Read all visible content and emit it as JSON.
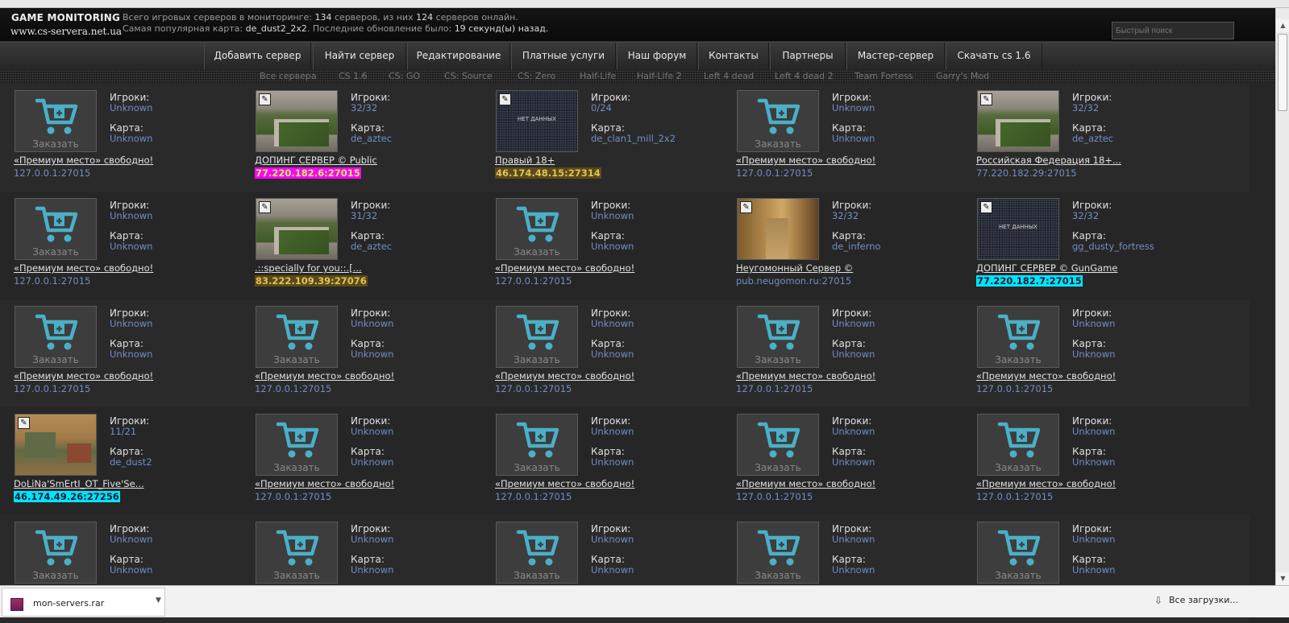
{
  "header": {
    "logo_title": "GAME MONITORING",
    "logo_url": "www.cs-servera.net.ua",
    "stats_line1_prefix": "Всего игровых серверов в мониторинге:",
    "stats_total": "134",
    "stats_line1_mid": "серверов, из них",
    "stats_online": "124",
    "stats_line1_suffix": "серверов онлайн.",
    "stats_line2_prefix": "Самая популярная карта:",
    "stats_popular_map": "de_dust2_2x2",
    "stats_line2_mid": ". Последние обновление было:",
    "stats_updated": "19 секунд(ы) назад.",
    "search_placeholder": "Быстрый поиск"
  },
  "nav": [
    "Добавить сервер",
    "Найти сервер",
    "Редактирование",
    "Платные услуги",
    "Наш форум",
    "Контакты",
    "Партнеры",
    "Мастер-сервер",
    "Скачать cs 1.6"
  ],
  "games": [
    "Все сервера",
    "CS 1.6",
    "CS: GO",
    "CS: Source",
    "CS: Zero",
    "Half-Life",
    "Half-Life 2",
    "Left 4 dead",
    "Left 4 dead 2",
    "Team Fortess",
    "Garry's Mod"
  ],
  "labels": {
    "players": "Игроки:",
    "map": "Карта:",
    "order": "Заказать",
    "no_data": "НЕТ ДАННЫХ",
    "cs_badge": "✎"
  },
  "servers": [
    [
      {
        "type": "premium",
        "players": "Unknown",
        "map": "Unknown",
        "name": "«Премиум место» свободно!",
        "ip": "127.0.0.1:27015",
        "ip_style": ""
      },
      {
        "type": "server",
        "image": "aztec",
        "players": "32/32",
        "map": "de_aztec",
        "name": "ДОПИНГ СЕРВЕР © Public",
        "ip": "77.220.182.6:27015",
        "ip_style": "magenta"
      },
      {
        "type": "server",
        "image": "nodata",
        "players": "0/24",
        "map": "de_clan1_mill_2x2",
        "name": "Правый 18+",
        "ip": "46.174.48.15:27314",
        "ip_style": "gold"
      },
      {
        "type": "premium",
        "players": "Unknown",
        "map": "Unknown",
        "name": "«Премиум место» свободно!",
        "ip": "127.0.0.1:27015",
        "ip_style": ""
      },
      {
        "type": "server",
        "image": "aztec",
        "players": "32/32",
        "map": "de_aztec",
        "name": "Российская Федерация 18+...",
        "ip": "77.220.182.29:27015",
        "ip_style": ""
      }
    ],
    [
      {
        "type": "premium",
        "players": "Unknown",
        "map": "Unknown",
        "name": "«Премиум место» свободно!",
        "ip": "127.0.0.1:27015",
        "ip_style": ""
      },
      {
        "type": "server",
        "image": "aztec",
        "players": "31/32",
        "map": "de_aztec",
        "name": ".::specially for you::.[...",
        "ip": "83.222.109.39:27076",
        "ip_style": "gold"
      },
      {
        "type": "premium",
        "players": "Unknown",
        "map": "Unknown",
        "name": "«Премиум место» свободно!",
        "ip": "127.0.0.1:27015",
        "ip_style": ""
      },
      {
        "type": "server",
        "image": "inferno",
        "players": "32/32",
        "map": "de_inferno",
        "name": "Неугомонный Сервер ©",
        "ip": "pub.neugomon.ru:27015",
        "ip_style": ""
      },
      {
        "type": "server",
        "image": "nodata",
        "players": "32/32",
        "map": "gg_dusty_fortress",
        "name": "ДОПИНГ СЕРВЕР © GunGame",
        "ip": "77.220.182.7:27015",
        "ip_style": "cyan"
      }
    ],
    [
      {
        "type": "premium",
        "players": "Unknown",
        "map": "Unknown",
        "name": "«Премиум место» свободно!",
        "ip": "127.0.0.1:27015",
        "ip_style": ""
      },
      {
        "type": "premium",
        "players": "Unknown",
        "map": "Unknown",
        "name": "«Премиум место» свободно!",
        "ip": "127.0.0.1:27015",
        "ip_style": ""
      },
      {
        "type": "premium",
        "players": "Unknown",
        "map": "Unknown",
        "name": "«Премиум место» свободно!",
        "ip": "127.0.0.1:27015",
        "ip_style": ""
      },
      {
        "type": "premium",
        "players": "Unknown",
        "map": "Unknown",
        "name": "«Премиум место» свободно!",
        "ip": "127.0.0.1:27015",
        "ip_style": ""
      },
      {
        "type": "premium",
        "players": "Unknown",
        "map": "Unknown",
        "name": "«Премиум место» свободно!",
        "ip": "127.0.0.1:27015",
        "ip_style": ""
      }
    ],
    [
      {
        "type": "server",
        "image": "dust2",
        "players": "11/21",
        "map": "de_dust2",
        "name": "DoLiNa'SmErtI_OT_Five'Se...",
        "ip": "46.174.49.26:27256",
        "ip_style": "cyan"
      },
      {
        "type": "premium",
        "players": "Unknown",
        "map": "Unknown",
        "name": "«Премиум место» свободно!",
        "ip": "127.0.0.1:27015",
        "ip_style": ""
      },
      {
        "type": "premium",
        "players": "Unknown",
        "map": "Unknown",
        "name": "«Премиум место» свободно!",
        "ip": "127.0.0.1:27015",
        "ip_style": ""
      },
      {
        "type": "premium",
        "players": "Unknown",
        "map": "Unknown",
        "name": "«Премиум место» свободно!",
        "ip": "127.0.0.1:27015",
        "ip_style": ""
      },
      {
        "type": "premium",
        "players": "Unknown",
        "map": "Unknown",
        "name": "«Премиум место» свободно!",
        "ip": "127.0.0.1:27015",
        "ip_style": ""
      }
    ],
    [
      {
        "type": "premium",
        "players": "Unknown",
        "map": "Unknown",
        "name": "",
        "ip": "",
        "ip_style": ""
      },
      {
        "type": "premium",
        "players": "Unknown",
        "map": "Unknown",
        "name": "",
        "ip": "",
        "ip_style": ""
      },
      {
        "type": "premium",
        "players": "Unknown",
        "map": "Unknown",
        "name": "",
        "ip": "",
        "ip_style": ""
      },
      {
        "type": "premium",
        "players": "Unknown",
        "map": "Unknown",
        "name": "",
        "ip": "",
        "ip_style": ""
      },
      {
        "type": "premium",
        "players": "Unknown",
        "map": "Unknown",
        "name": "",
        "ip": "",
        "ip_style": ""
      }
    ]
  ],
  "downloads": {
    "file": "mon-servers.rar",
    "all": "Все загрузки..."
  },
  "colors": {
    "link_blue": "#6f8fc8",
    "cart_teal": "#4ab0c8",
    "hl_magenta": "#ff00ff",
    "hl_cyan": "#00e5ff",
    "hl_gold": "#5a4a16"
  }
}
